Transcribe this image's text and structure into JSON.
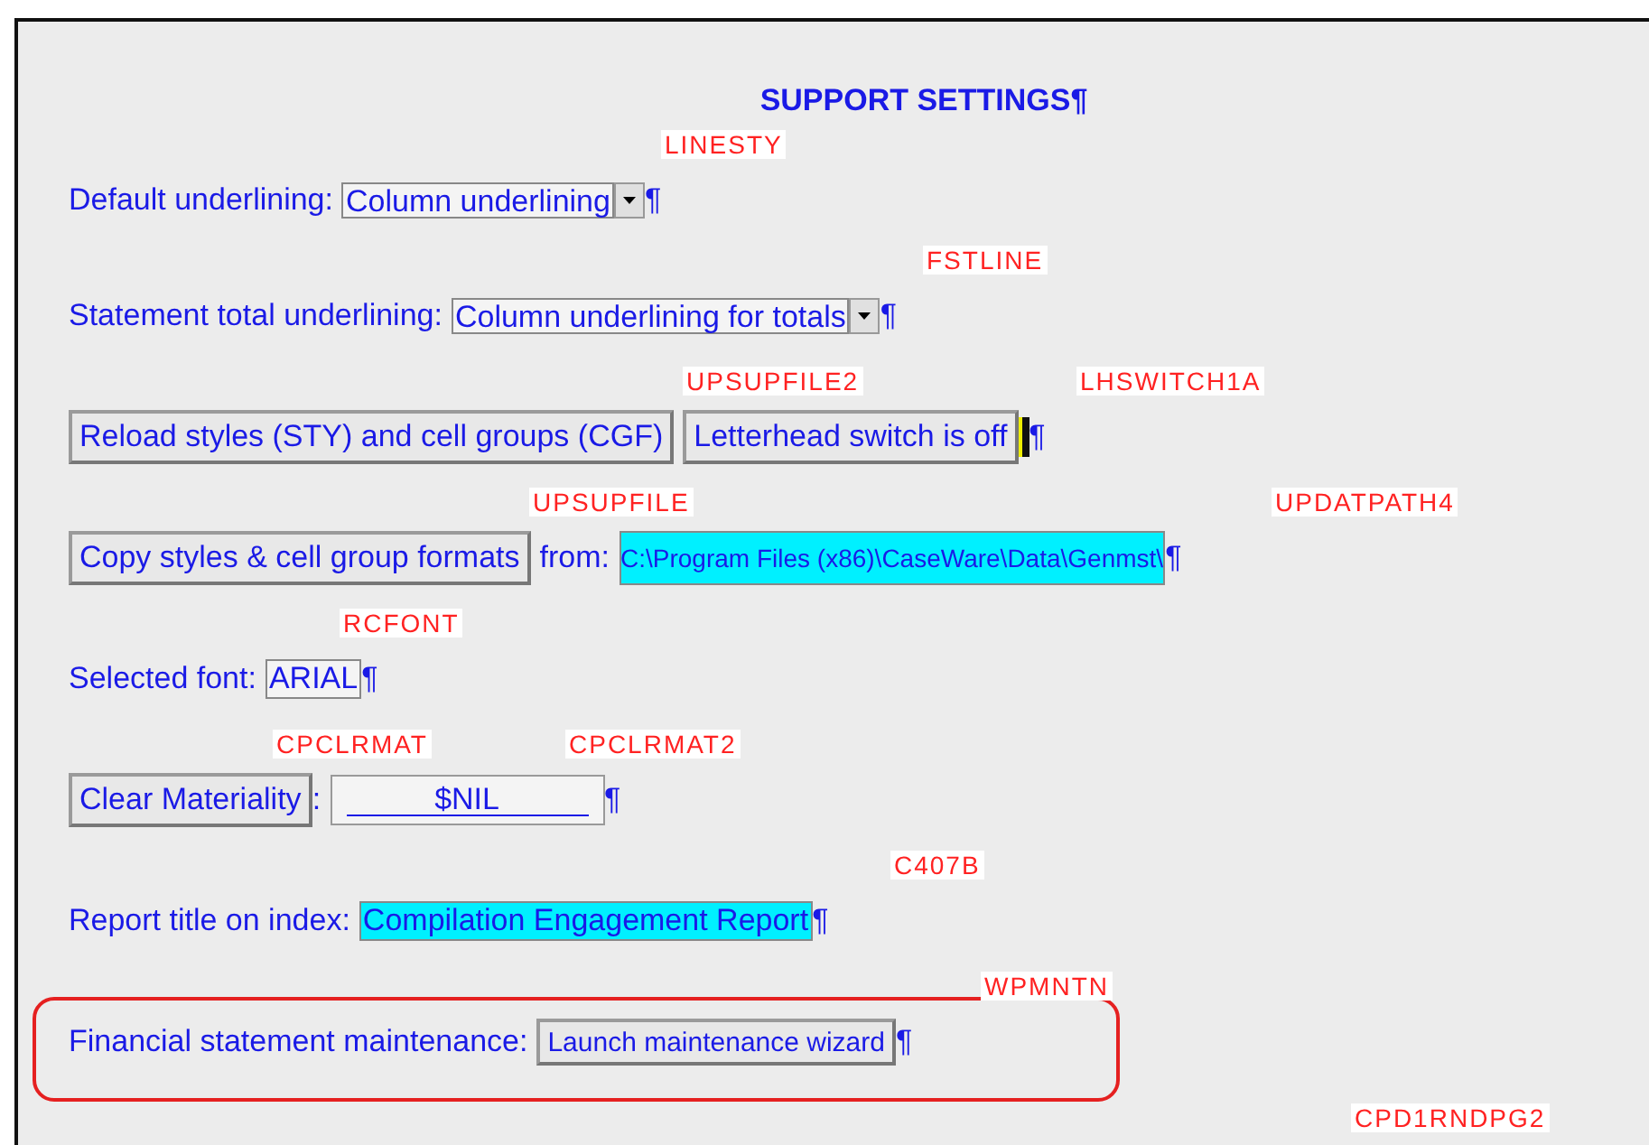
{
  "title": "SUPPORT SETTINGS",
  "title_mark": "¶",
  "lines": [
    {
      "outlined": false,
      "tags": [
        "LINESTY"
      ],
      "parts": [
        {
          "kind": "label",
          "text": "Default underlining:"
        },
        {
          "kind": "dropdown",
          "value": "Column underlining"
        },
        {
          "kind": "mark",
          "text": "¶"
        }
      ]
    },
    {
      "outlined": false,
      "tags": [
        "FSTLINE"
      ],
      "parts": [
        {
          "kind": "label",
          "text": "Statement total underlining:"
        },
        {
          "kind": "dropdown",
          "value": "Column underlining for totals"
        },
        {
          "kind": "mark",
          "text": "¶"
        }
      ]
    },
    {
      "outlined": false,
      "tags": [
        "UPSUPFILE2",
        "LHSWITCH1A"
      ],
      "parts": [
        {
          "kind": "button",
          "text": "Reload styles (STY) and cell groups (CGF)"
        },
        {
          "kind": "button",
          "text": "Letterhead switch is off"
        },
        {
          "kind": "cursor"
        },
        {
          "kind": "mark",
          "text": "¶"
        }
      ]
    },
    {
      "outlined": false,
      "tags": [
        "UPSUPFILE",
        "UPDATPATH4"
      ],
      "parts": [
        {
          "kind": "button",
          "text": "Copy styles & cell group formats"
        },
        {
          "kind": "label",
          "text": "from:"
        },
        {
          "kind": "field",
          "value": "C:\\Program Files (x86)\\CaseWare\\Data\\Genmst\\",
          "highlighted": true,
          "small": true
        },
        {
          "kind": "mark",
          "text": "¶"
        }
      ]
    },
    {
      "outlined": false,
      "tags": [
        "RCFONT"
      ],
      "parts": [
        {
          "kind": "label",
          "text": "Selected font:"
        },
        {
          "kind": "field",
          "value": "ARIAL",
          "highlighted": false
        },
        {
          "kind": "mark",
          "text": "¶"
        }
      ]
    },
    {
      "outlined": false,
      "tags": [
        "CPCLRMAT",
        "CPCLRMAT2"
      ],
      "parts": [
        {
          "kind": "button",
          "text": "Clear Materiality"
        },
        {
          "kind": "label",
          "text": ":"
        },
        {
          "kind": "underlined",
          "value": "$NIL"
        },
        {
          "kind": "mark",
          "text": "¶"
        }
      ]
    },
    {
      "outlined": false,
      "tags": [
        "C407B"
      ],
      "parts": [
        {
          "kind": "label",
          "text": "Report title on index:"
        },
        {
          "kind": "field",
          "value": "Compilation Engagement Report",
          "highlighted": true
        },
        {
          "kind": "mark",
          "text": "¶"
        }
      ]
    },
    {
      "outlined": true,
      "tags": [
        "WPMNTN"
      ],
      "parts": [
        {
          "kind": "label",
          "text": "Financial statement maintenance:"
        },
        {
          "kind": "button",
          "text": "Launch maintenance wizard",
          "small": true
        },
        {
          "kind": "mark",
          "text": "¶"
        }
      ]
    }
  ],
  "bottom_tags": [
    "CPD1RNDPG2"
  ]
}
